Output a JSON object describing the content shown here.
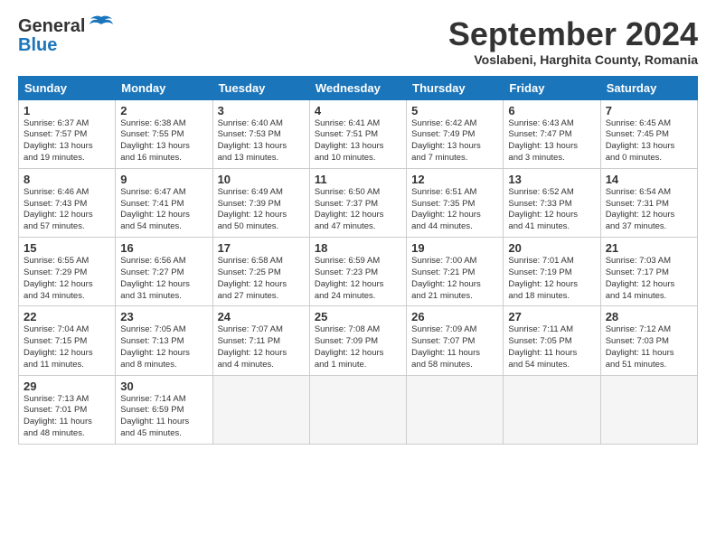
{
  "logo": {
    "text1": "General",
    "text2": "Blue"
  },
  "title": "September 2024",
  "subtitle": "Voslabeni, Harghita County, Romania",
  "headers": [
    "Sunday",
    "Monday",
    "Tuesday",
    "Wednesday",
    "Thursday",
    "Friday",
    "Saturday"
  ],
  "weeks": [
    [
      {
        "day": "1",
        "info": "Sunrise: 6:37 AM\nSunset: 7:57 PM\nDaylight: 13 hours\nand 19 minutes."
      },
      {
        "day": "2",
        "info": "Sunrise: 6:38 AM\nSunset: 7:55 PM\nDaylight: 13 hours\nand 16 minutes."
      },
      {
        "day": "3",
        "info": "Sunrise: 6:40 AM\nSunset: 7:53 PM\nDaylight: 13 hours\nand 13 minutes."
      },
      {
        "day": "4",
        "info": "Sunrise: 6:41 AM\nSunset: 7:51 PM\nDaylight: 13 hours\nand 10 minutes."
      },
      {
        "day": "5",
        "info": "Sunrise: 6:42 AM\nSunset: 7:49 PM\nDaylight: 13 hours\nand 7 minutes."
      },
      {
        "day": "6",
        "info": "Sunrise: 6:43 AM\nSunset: 7:47 PM\nDaylight: 13 hours\nand 3 minutes."
      },
      {
        "day": "7",
        "info": "Sunrise: 6:45 AM\nSunset: 7:45 PM\nDaylight: 13 hours\nand 0 minutes."
      }
    ],
    [
      {
        "day": "8",
        "info": "Sunrise: 6:46 AM\nSunset: 7:43 PM\nDaylight: 12 hours\nand 57 minutes."
      },
      {
        "day": "9",
        "info": "Sunrise: 6:47 AM\nSunset: 7:41 PM\nDaylight: 12 hours\nand 54 minutes."
      },
      {
        "day": "10",
        "info": "Sunrise: 6:49 AM\nSunset: 7:39 PM\nDaylight: 12 hours\nand 50 minutes."
      },
      {
        "day": "11",
        "info": "Sunrise: 6:50 AM\nSunset: 7:37 PM\nDaylight: 12 hours\nand 47 minutes."
      },
      {
        "day": "12",
        "info": "Sunrise: 6:51 AM\nSunset: 7:35 PM\nDaylight: 12 hours\nand 44 minutes."
      },
      {
        "day": "13",
        "info": "Sunrise: 6:52 AM\nSunset: 7:33 PM\nDaylight: 12 hours\nand 41 minutes."
      },
      {
        "day": "14",
        "info": "Sunrise: 6:54 AM\nSunset: 7:31 PM\nDaylight: 12 hours\nand 37 minutes."
      }
    ],
    [
      {
        "day": "15",
        "info": "Sunrise: 6:55 AM\nSunset: 7:29 PM\nDaylight: 12 hours\nand 34 minutes."
      },
      {
        "day": "16",
        "info": "Sunrise: 6:56 AM\nSunset: 7:27 PM\nDaylight: 12 hours\nand 31 minutes."
      },
      {
        "day": "17",
        "info": "Sunrise: 6:58 AM\nSunset: 7:25 PM\nDaylight: 12 hours\nand 27 minutes."
      },
      {
        "day": "18",
        "info": "Sunrise: 6:59 AM\nSunset: 7:23 PM\nDaylight: 12 hours\nand 24 minutes."
      },
      {
        "day": "19",
        "info": "Sunrise: 7:00 AM\nSunset: 7:21 PM\nDaylight: 12 hours\nand 21 minutes."
      },
      {
        "day": "20",
        "info": "Sunrise: 7:01 AM\nSunset: 7:19 PM\nDaylight: 12 hours\nand 18 minutes."
      },
      {
        "day": "21",
        "info": "Sunrise: 7:03 AM\nSunset: 7:17 PM\nDaylight: 12 hours\nand 14 minutes."
      }
    ],
    [
      {
        "day": "22",
        "info": "Sunrise: 7:04 AM\nSunset: 7:15 PM\nDaylight: 12 hours\nand 11 minutes."
      },
      {
        "day": "23",
        "info": "Sunrise: 7:05 AM\nSunset: 7:13 PM\nDaylight: 12 hours\nand 8 minutes."
      },
      {
        "day": "24",
        "info": "Sunrise: 7:07 AM\nSunset: 7:11 PM\nDaylight: 12 hours\nand 4 minutes."
      },
      {
        "day": "25",
        "info": "Sunrise: 7:08 AM\nSunset: 7:09 PM\nDaylight: 12 hours\nand 1 minute."
      },
      {
        "day": "26",
        "info": "Sunrise: 7:09 AM\nSunset: 7:07 PM\nDaylight: 11 hours\nand 58 minutes."
      },
      {
        "day": "27",
        "info": "Sunrise: 7:11 AM\nSunset: 7:05 PM\nDaylight: 11 hours\nand 54 minutes."
      },
      {
        "day": "28",
        "info": "Sunrise: 7:12 AM\nSunset: 7:03 PM\nDaylight: 11 hours\nand 51 minutes."
      }
    ],
    [
      {
        "day": "29",
        "info": "Sunrise: 7:13 AM\nSunset: 7:01 PM\nDaylight: 11 hours\nand 48 minutes."
      },
      {
        "day": "30",
        "info": "Sunrise: 7:14 AM\nSunset: 6:59 PM\nDaylight: 11 hours\nand 45 minutes."
      },
      {
        "day": "",
        "info": ""
      },
      {
        "day": "",
        "info": ""
      },
      {
        "day": "",
        "info": ""
      },
      {
        "day": "",
        "info": ""
      },
      {
        "day": "",
        "info": ""
      }
    ]
  ]
}
